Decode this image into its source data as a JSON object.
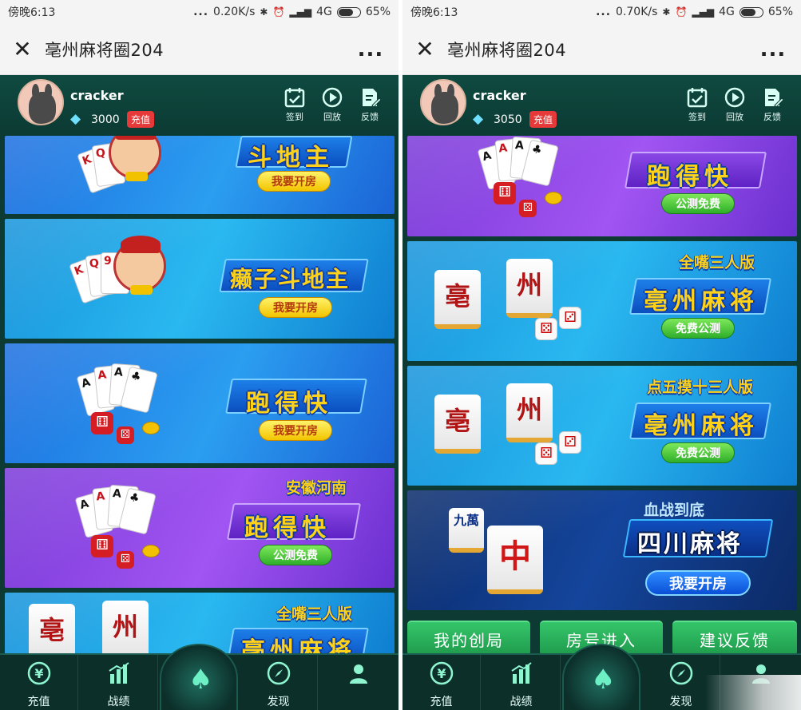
{
  "panels": [
    {
      "status": {
        "time": "傍晚6:13",
        "dots": "...",
        "speed": "0.20K/s",
        "network": "4G",
        "battery": "65%"
      },
      "title": "亳州麻将圈204",
      "more": "...",
      "user": {
        "name": "cracker",
        "coins": "3000",
        "recharge": "充值"
      },
      "tools": [
        "签到",
        "回放",
        "反馈"
      ],
      "banners": [
        {
          "title": "斗地主",
          "button": "我要开房"
        },
        {
          "title": "癞子斗地主",
          "button": "我要开房"
        },
        {
          "title": "跑得快",
          "button": "我要开房"
        },
        {
          "tag": "安徽河南",
          "title": "跑得快",
          "button": "公测免费"
        },
        {
          "tag": "全嘴三人版",
          "title": "亳州麻将",
          "tile1": "亳",
          "tile2": "州"
        }
      ],
      "tabs": [
        "充值",
        "战绩",
        "发现",
        ""
      ]
    },
    {
      "status": {
        "time": "傍晚6:13",
        "dots": "...",
        "speed": "0.70K/s",
        "network": "4G",
        "battery": "65%"
      },
      "title": "亳州麻将圈204",
      "more": "...",
      "user": {
        "name": "cracker",
        "coins": "3050",
        "recharge": "充值"
      },
      "tools": [
        "签到",
        "回放",
        "反馈"
      ],
      "banners": [
        {
          "title": "跑得快",
          "button": "公测免费"
        },
        {
          "tag": "全嘴三人版",
          "title": "亳州麻将",
          "button": "免费公测",
          "tile1": "亳",
          "tile2": "州"
        },
        {
          "tag": "点五摸十三人版",
          "title": "亳州麻将",
          "button": "免费公测",
          "tile1": "亳",
          "tile2": "州"
        },
        {
          "tag": "血战到底",
          "title": "四川麻将",
          "button": "我要开房",
          "tile1": "九萬",
          "tile2": "中"
        }
      ],
      "actions": [
        "我的创局",
        "房号进入",
        "建议反馈"
      ],
      "tabs": [
        "充值",
        "战绩",
        "发现",
        ""
      ]
    }
  ],
  "icons": {
    "close": "close-icon",
    "more": "more-icon",
    "diamond": "diamond-icon",
    "checkin": "calendar-check-icon",
    "replay": "play-circle-icon",
    "feedback": "edit-doc-icon",
    "yen": "yen-icon",
    "stats": "bar-chart-icon",
    "spade": "spade-icon",
    "compass": "compass-icon",
    "user": "user-icon"
  },
  "colors": {
    "app_bg": "#0d3b34",
    "recharge_red": "#e63a3a",
    "action_green": "#2db35c",
    "title_yellow": "#ffd21a"
  }
}
